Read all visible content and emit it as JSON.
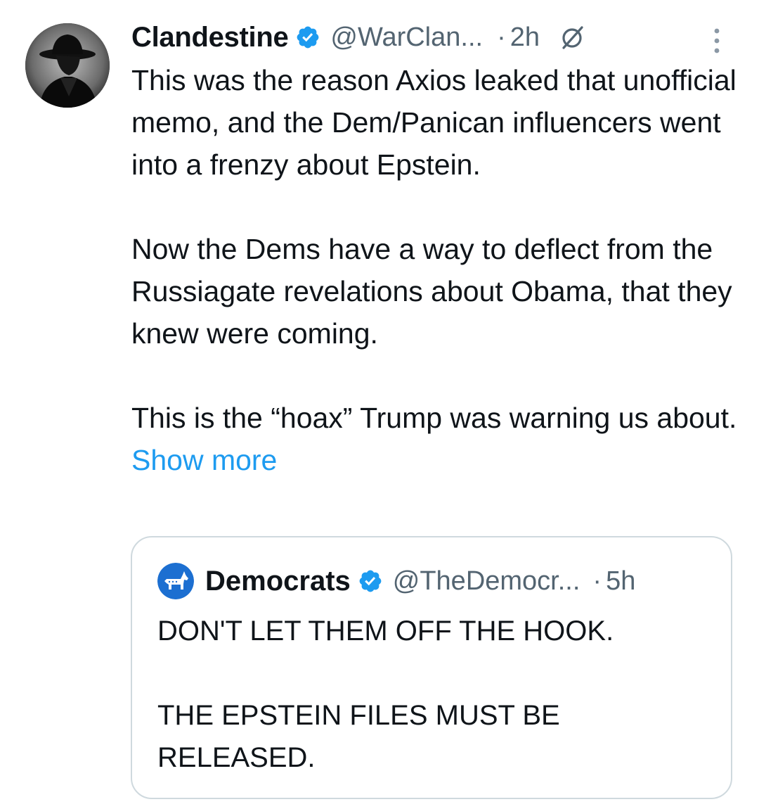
{
  "tweet": {
    "author_name": "Clandestine",
    "handle": "@WarClan...",
    "separator": "·",
    "time": "2h",
    "avatar_icon": "fedora-silhouette-avatar",
    "verified_icon": "verified-badge-icon",
    "grok_icon": "grok-icon",
    "more_icon": "more-options-icon",
    "paragraphs": [
      "This was the reason Axios leaked that unofficial memo, and the Dem/Panican influencers went into a frenzy about Epstein.",
      "Now the Dems have a way to deflect from the Russiagate revelations about Obama, that they knew were coming.",
      "This is the “hoax” Trump was warning us about."
    ],
    "show_more": "Show more"
  },
  "quoted": {
    "author_name": "Democrats",
    "handle": "@TheDemocr...",
    "separator": "·",
    "time": "5h",
    "avatar_icon": "donkey-logo-icon",
    "paragraphs": [
      "DON'T LET THEM OFF THE HOOK.",
      "THE EPSTEIN FILES MUST BE RELEASED."
    ]
  },
  "colors": {
    "text": "#0f1419",
    "secondary": "#536471",
    "link": "#1d9bf0",
    "border": "#cfd9de",
    "democrats_blue": "#1c6fd1"
  }
}
